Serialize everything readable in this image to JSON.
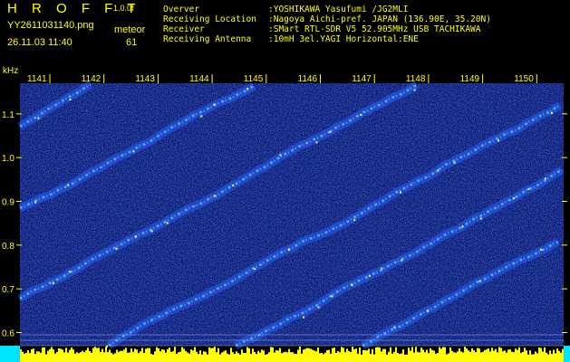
{
  "header": {
    "brand": "H R O F F T",
    "version": "1.0.0f",
    "filename": "YY2611031140.png",
    "mode": "meteor",
    "datetime": "26.11.03 11:40",
    "count": "61"
  },
  "info": [
    {
      "label": "Overver",
      "value": ":YOSHIKAWA Yasufumi /JG2MLI"
    },
    {
      "label": "Receiving Location",
      "value": ":Nagoya Aichi-pref. JAPAN (136.90E, 35.20N)"
    },
    {
      "label": "Receiver",
      "value": ":SMart RTL-SDR V5 52.905MHz USB TACHIKAWA"
    },
    {
      "label": "Receiving Antenna",
      "value": ":10mH 3el.YAGI Horizontal:ENE"
    }
  ],
  "spectrogram": {
    "unit": "kHz",
    "time_ticks": [
      "1141",
      "1142",
      "1143",
      "1144",
      "1145",
      "1146",
      "1147",
      "1148",
      "1149",
      "1150"
    ],
    "freq_ticks": [
      "1.1",
      "1.0",
      "0.9",
      "0.8",
      "0.7",
      "0.6"
    ],
    "freq_range_khz": [
      0.57,
      1.17
    ],
    "colors": {
      "background": "#000000",
      "noise_low": "#0a1fa8",
      "noise_high": "#2f5cff",
      "signal": "#33e0ff",
      "signal_peak": "#ffff66",
      "baseline": "#ffff00",
      "baseline_edge": "#00e5ff",
      "label": "#ffff00"
    }
  }
}
